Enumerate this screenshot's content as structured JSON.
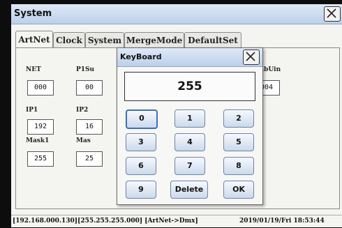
{
  "window": {
    "title": "System"
  },
  "tabs": [
    {
      "label": "ArtNet",
      "active": true
    },
    {
      "label": "Clock",
      "active": false
    },
    {
      "label": "System",
      "active": false
    },
    {
      "label": "MergeMode",
      "active": false
    },
    {
      "label": "DefaultSet",
      "active": false
    }
  ],
  "fields": {
    "net": {
      "label": "NET",
      "value": "000"
    },
    "p1su": {
      "label": "P1Su",
      "value": "00"
    },
    "subuin": {
      "label": "SubUin",
      "value": "004"
    },
    "ip1": {
      "label": "IP1",
      "value": "192"
    },
    "ip2": {
      "label": "IP2",
      "value": "16"
    },
    "mask1": {
      "label": "Mask1",
      "value": "255"
    },
    "mask2": {
      "label": "Mas",
      "value": "25"
    }
  },
  "keyboard": {
    "title": "KeyBoard",
    "display": "255",
    "keys": [
      "0",
      "1",
      "2",
      "3",
      "4",
      "5",
      "6",
      "7",
      "8",
      "9",
      "Delete",
      "OK"
    ]
  },
  "status": {
    "left": "[192.168.000.130][255.255.255.000] [ArtNet->Dmx]",
    "right": "2019/01/19/Fri 18:53:44"
  },
  "icons": {
    "close": "close-icon"
  },
  "colors": {
    "titlebar": "#bcd0ea",
    "key_border": "#6c84a6",
    "selected_key": "#3d6fb8"
  }
}
